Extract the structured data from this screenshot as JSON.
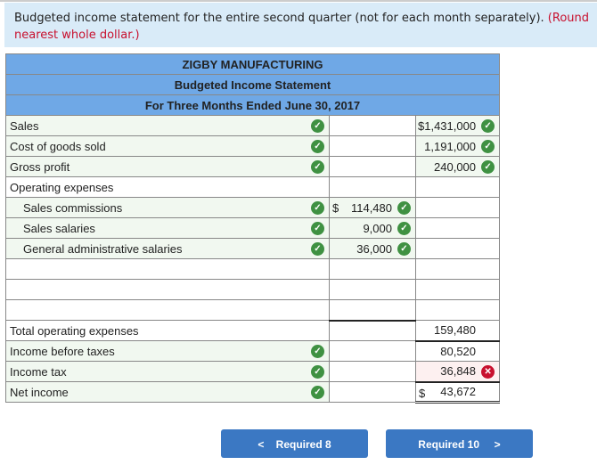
{
  "instructions": {
    "text": "Budgeted income statement for the entire second quarter (not for each month separately).",
    "note": "(Round to the nearest whole dollar.)",
    "note_visible_line1": "(Round",
    "note_visible_line2": "nearest whole dollar.)"
  },
  "header": {
    "company": "ZIGBY MANUFACTURING",
    "statement": "Budgeted Income Statement",
    "period": "For Three Months Ended June 30, 2017"
  },
  "rows": [
    {
      "label": "Sales",
      "mid": "",
      "right": "$1,431,000",
      "label_status": "correct",
      "right_status": "correct"
    },
    {
      "label": "Cost of goods sold",
      "mid": "",
      "right": "1,191,000",
      "label_status": "correct",
      "right_status": "correct"
    },
    {
      "label": "Gross profit",
      "mid": "",
      "right": "240,000",
      "label_status": "correct",
      "right_status": "correct"
    },
    {
      "label": "Operating expenses",
      "mid": "",
      "right": ""
    },
    {
      "label": "Sales commissions",
      "mid": "114,480",
      "mid_prefix": "$",
      "right": "",
      "label_status": "correct",
      "mid_status": "correct"
    },
    {
      "label": "Sales salaries",
      "mid": "9,000",
      "right": "",
      "label_status": "correct",
      "mid_status": "correct"
    },
    {
      "label": "General administrative salaries",
      "mid": "36,000",
      "right": "",
      "label_status": "correct",
      "mid_status": "correct"
    },
    {
      "label": "",
      "mid": "",
      "right": ""
    },
    {
      "label": "",
      "mid": "",
      "right": ""
    },
    {
      "label": "",
      "mid": "",
      "right": ""
    },
    {
      "label": "Total operating expenses",
      "mid": "",
      "right": "159,480"
    },
    {
      "label": "Income before taxes",
      "mid": "",
      "right": "80,520",
      "label_status": "correct"
    },
    {
      "label": "Income tax",
      "mid": "",
      "right": "36,848",
      "label_status": "correct",
      "right_status": "incorrect"
    },
    {
      "label": "Net income",
      "mid": "",
      "right": "43,672",
      "right_prefix": "$",
      "label_status": "correct"
    }
  ],
  "nav": {
    "prev": "Required 8",
    "next": "Required 10"
  },
  "colors": {
    "header": "#6fa8e6",
    "correct": "#3f9142",
    "incorrect": "#c8102e",
    "button": "#3b78c3"
  }
}
